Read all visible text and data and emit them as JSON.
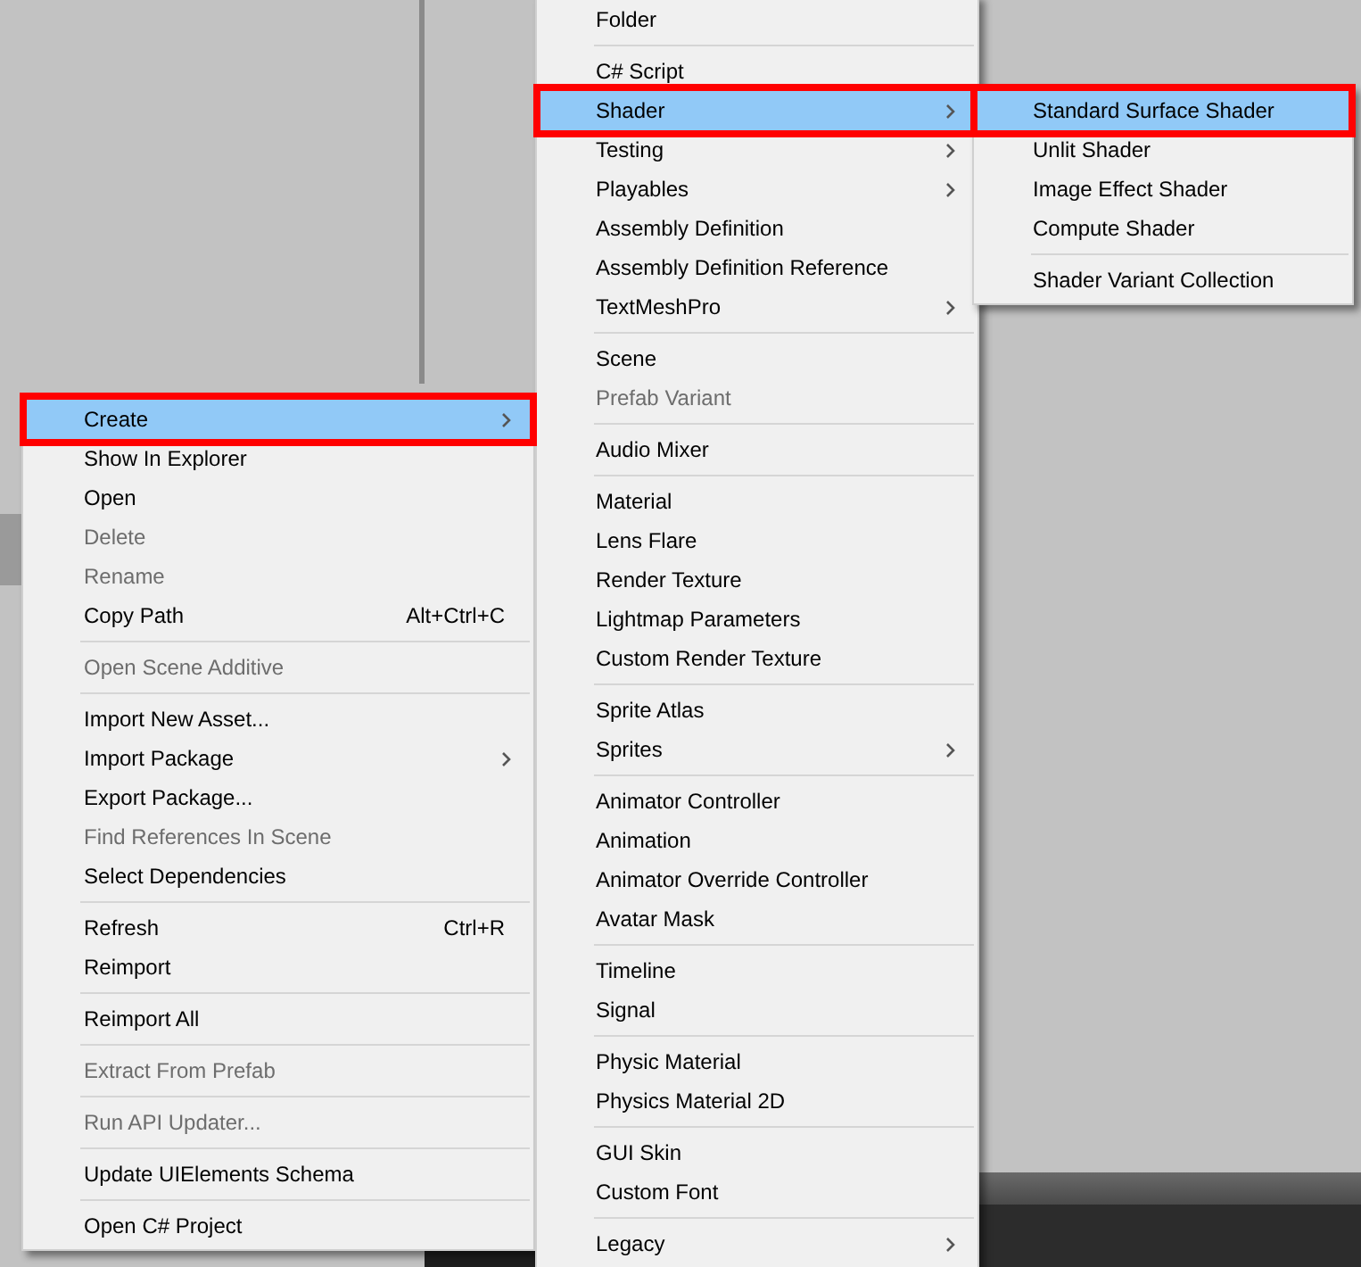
{
  "context_menu": {
    "items": [
      {
        "kind": "item",
        "label": "Create",
        "submenu": true,
        "disabled": false,
        "selected": true,
        "annotated": true
      },
      {
        "kind": "item",
        "label": "Show In Explorer",
        "submenu": false,
        "disabled": false,
        "selected": false,
        "annotated": false
      },
      {
        "kind": "item",
        "label": "Open",
        "submenu": false,
        "disabled": false,
        "selected": false,
        "annotated": false
      },
      {
        "kind": "item",
        "label": "Delete",
        "submenu": false,
        "disabled": true,
        "selected": false,
        "annotated": false
      },
      {
        "kind": "item",
        "label": "Rename",
        "submenu": false,
        "disabled": true,
        "selected": false,
        "annotated": false
      },
      {
        "kind": "item",
        "label": "Copy Path",
        "shortcut": "Alt+Ctrl+C",
        "submenu": false,
        "disabled": false,
        "selected": false,
        "annotated": false
      },
      {
        "kind": "separator"
      },
      {
        "kind": "item",
        "label": "Open Scene Additive",
        "submenu": false,
        "disabled": true,
        "selected": false,
        "annotated": false
      },
      {
        "kind": "separator"
      },
      {
        "kind": "item",
        "label": "Import New Asset...",
        "submenu": false,
        "disabled": false,
        "selected": false,
        "annotated": false
      },
      {
        "kind": "item",
        "label": "Import Package",
        "submenu": true,
        "disabled": false,
        "selected": false,
        "annotated": false
      },
      {
        "kind": "item",
        "label": "Export Package...",
        "submenu": false,
        "disabled": false,
        "selected": false,
        "annotated": false
      },
      {
        "kind": "item",
        "label": "Find References In Scene",
        "submenu": false,
        "disabled": true,
        "selected": false,
        "annotated": false
      },
      {
        "kind": "item",
        "label": "Select Dependencies",
        "submenu": false,
        "disabled": false,
        "selected": false,
        "annotated": false
      },
      {
        "kind": "separator"
      },
      {
        "kind": "item",
        "label": "Refresh",
        "shortcut": "Ctrl+R",
        "submenu": false,
        "disabled": false,
        "selected": false,
        "annotated": false
      },
      {
        "kind": "item",
        "label": "Reimport",
        "submenu": false,
        "disabled": false,
        "selected": false,
        "annotated": false
      },
      {
        "kind": "separator"
      },
      {
        "kind": "item",
        "label": "Reimport All",
        "submenu": false,
        "disabled": false,
        "selected": false,
        "annotated": false
      },
      {
        "kind": "separator"
      },
      {
        "kind": "item",
        "label": "Extract From Prefab",
        "submenu": false,
        "disabled": true,
        "selected": false,
        "annotated": false
      },
      {
        "kind": "separator"
      },
      {
        "kind": "item",
        "label": "Run API Updater...",
        "submenu": false,
        "disabled": true,
        "selected": false,
        "annotated": false
      },
      {
        "kind": "separator"
      },
      {
        "kind": "item",
        "label": "Update UIElements Schema",
        "submenu": false,
        "disabled": false,
        "selected": false,
        "annotated": false
      },
      {
        "kind": "separator"
      },
      {
        "kind": "item",
        "label": "Open C# Project",
        "submenu": false,
        "disabled": false,
        "selected": false,
        "annotated": false
      }
    ]
  },
  "create_submenu": {
    "items": [
      {
        "kind": "item",
        "label": "Folder",
        "submenu": false,
        "disabled": false,
        "selected": false,
        "annotated": false
      },
      {
        "kind": "separator"
      },
      {
        "kind": "item",
        "label": "C# Script",
        "submenu": false,
        "disabled": false,
        "selected": false,
        "annotated": false
      },
      {
        "kind": "item",
        "label": "Shader",
        "submenu": true,
        "disabled": false,
        "selected": true,
        "annotated": true
      },
      {
        "kind": "item",
        "label": "Testing",
        "submenu": true,
        "disabled": false,
        "selected": false,
        "annotated": false
      },
      {
        "kind": "item",
        "label": "Playables",
        "submenu": true,
        "disabled": false,
        "selected": false,
        "annotated": false
      },
      {
        "kind": "item",
        "label": "Assembly Definition",
        "submenu": false,
        "disabled": false,
        "selected": false,
        "annotated": false
      },
      {
        "kind": "item",
        "label": "Assembly Definition Reference",
        "submenu": false,
        "disabled": false,
        "selected": false,
        "annotated": false
      },
      {
        "kind": "item",
        "label": "TextMeshPro",
        "submenu": true,
        "disabled": false,
        "selected": false,
        "annotated": false
      },
      {
        "kind": "separator"
      },
      {
        "kind": "item",
        "label": "Scene",
        "submenu": false,
        "disabled": false,
        "selected": false,
        "annotated": false
      },
      {
        "kind": "item",
        "label": "Prefab Variant",
        "submenu": false,
        "disabled": true,
        "selected": false,
        "annotated": false
      },
      {
        "kind": "separator"
      },
      {
        "kind": "item",
        "label": "Audio Mixer",
        "submenu": false,
        "disabled": false,
        "selected": false,
        "annotated": false
      },
      {
        "kind": "separator"
      },
      {
        "kind": "item",
        "label": "Material",
        "submenu": false,
        "disabled": false,
        "selected": false,
        "annotated": false
      },
      {
        "kind": "item",
        "label": "Lens Flare",
        "submenu": false,
        "disabled": false,
        "selected": false,
        "annotated": false
      },
      {
        "kind": "item",
        "label": "Render Texture",
        "submenu": false,
        "disabled": false,
        "selected": false,
        "annotated": false
      },
      {
        "kind": "item",
        "label": "Lightmap Parameters",
        "submenu": false,
        "disabled": false,
        "selected": false,
        "annotated": false
      },
      {
        "kind": "item",
        "label": "Custom Render Texture",
        "submenu": false,
        "disabled": false,
        "selected": false,
        "annotated": false
      },
      {
        "kind": "separator"
      },
      {
        "kind": "item",
        "label": "Sprite Atlas",
        "submenu": false,
        "disabled": false,
        "selected": false,
        "annotated": false
      },
      {
        "kind": "item",
        "label": "Sprites",
        "submenu": true,
        "disabled": false,
        "selected": false,
        "annotated": false
      },
      {
        "kind": "separator"
      },
      {
        "kind": "item",
        "label": "Animator Controller",
        "submenu": false,
        "disabled": false,
        "selected": false,
        "annotated": false
      },
      {
        "kind": "item",
        "label": "Animation",
        "submenu": false,
        "disabled": false,
        "selected": false,
        "annotated": false
      },
      {
        "kind": "item",
        "label": "Animator Override Controller",
        "submenu": false,
        "disabled": false,
        "selected": false,
        "annotated": false
      },
      {
        "kind": "item",
        "label": "Avatar Mask",
        "submenu": false,
        "disabled": false,
        "selected": false,
        "annotated": false
      },
      {
        "kind": "separator"
      },
      {
        "kind": "item",
        "label": "Timeline",
        "submenu": false,
        "disabled": false,
        "selected": false,
        "annotated": false
      },
      {
        "kind": "item",
        "label": "Signal",
        "submenu": false,
        "disabled": false,
        "selected": false,
        "annotated": false
      },
      {
        "kind": "separator"
      },
      {
        "kind": "item",
        "label": "Physic Material",
        "submenu": false,
        "disabled": false,
        "selected": false,
        "annotated": false
      },
      {
        "kind": "item",
        "label": "Physics Material 2D",
        "submenu": false,
        "disabled": false,
        "selected": false,
        "annotated": false
      },
      {
        "kind": "separator"
      },
      {
        "kind": "item",
        "label": "GUI Skin",
        "submenu": false,
        "disabled": false,
        "selected": false,
        "annotated": false
      },
      {
        "kind": "item",
        "label": "Custom Font",
        "submenu": false,
        "disabled": false,
        "selected": false,
        "annotated": false
      },
      {
        "kind": "separator"
      },
      {
        "kind": "item",
        "label": "Legacy",
        "submenu": true,
        "disabled": false,
        "selected": false,
        "annotated": false
      }
    ]
  },
  "shader_submenu": {
    "items": [
      {
        "kind": "item",
        "label": "Standard Surface Shader",
        "submenu": false,
        "disabled": false,
        "selected": true,
        "annotated": true
      },
      {
        "kind": "item",
        "label": "Unlit Shader",
        "submenu": false,
        "disabled": false,
        "selected": false,
        "annotated": false
      },
      {
        "kind": "item",
        "label": "Image Effect Shader",
        "submenu": false,
        "disabled": false,
        "selected": false,
        "annotated": false
      },
      {
        "kind": "item",
        "label": "Compute Shader",
        "submenu": false,
        "disabled": false,
        "selected": false,
        "annotated": false
      },
      {
        "kind": "separator"
      },
      {
        "kind": "item",
        "label": "Shader Variant Collection",
        "submenu": false,
        "disabled": false,
        "selected": false,
        "annotated": false
      }
    ]
  }
}
